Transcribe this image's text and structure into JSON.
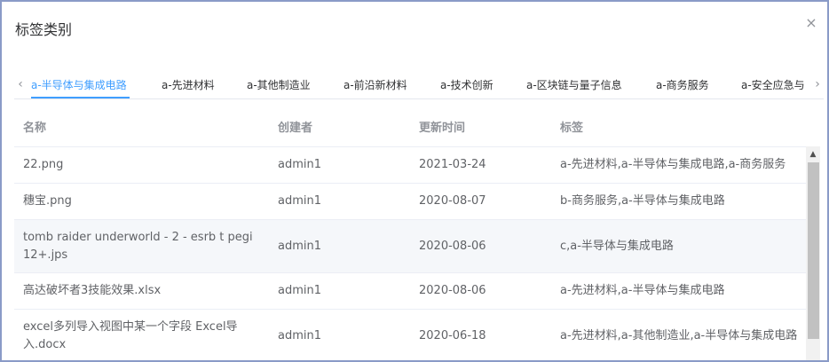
{
  "dialog": {
    "title": "标签类别",
    "close_glyph": "×"
  },
  "tabs": {
    "prev_glyph": "‹",
    "next_glyph": "›",
    "items": [
      {
        "label": "a-半导体与集成电路",
        "active": true
      },
      {
        "label": "a-先进材料"
      },
      {
        "label": "a-其他制造业"
      },
      {
        "label": "a-前沿新材料"
      },
      {
        "label": "a-技术创新"
      },
      {
        "label": "a-区块链与量子信息"
      },
      {
        "label": "a-商务服务"
      },
      {
        "label": "a-安全应急与"
      }
    ],
    "accent": "#409eff"
  },
  "table": {
    "headers": {
      "name": "名称",
      "creator": "创建者",
      "updated": "更新时间",
      "tags": "标签"
    },
    "rows": [
      {
        "name": "22.png",
        "creator": "admin1",
        "updated": "2021-03-24",
        "tags": "a-先进材料,a-半导体与集成电路,a-商务服务"
      },
      {
        "name": "穗宝.png",
        "creator": "admin1",
        "updated": "2020-08-07",
        "tags": "b-商务服务,a-半导体与集成电路"
      },
      {
        "name": "tomb raider underworld - 2 - esrb t pegi 12+.jps",
        "creator": "admin1",
        "updated": "2020-08-06",
        "tags": "c,a-半导体与集成电路"
      },
      {
        "name": "高达破坏者3技能效果.xlsx",
        "creator": "admin1",
        "updated": "2020-08-06",
        "tags": "a-先进材料,a-半导体与集成电路"
      },
      {
        "name": " excel多列导入视图中某一个字段 Excel导入.docx",
        "creator": "admin1",
        "updated": "2020-06-18",
        "tags": "a-先进材料,a-其他制造业,a-半导体与集成电路"
      }
    ]
  },
  "scrollbar": {
    "up_glyph": "▲"
  }
}
